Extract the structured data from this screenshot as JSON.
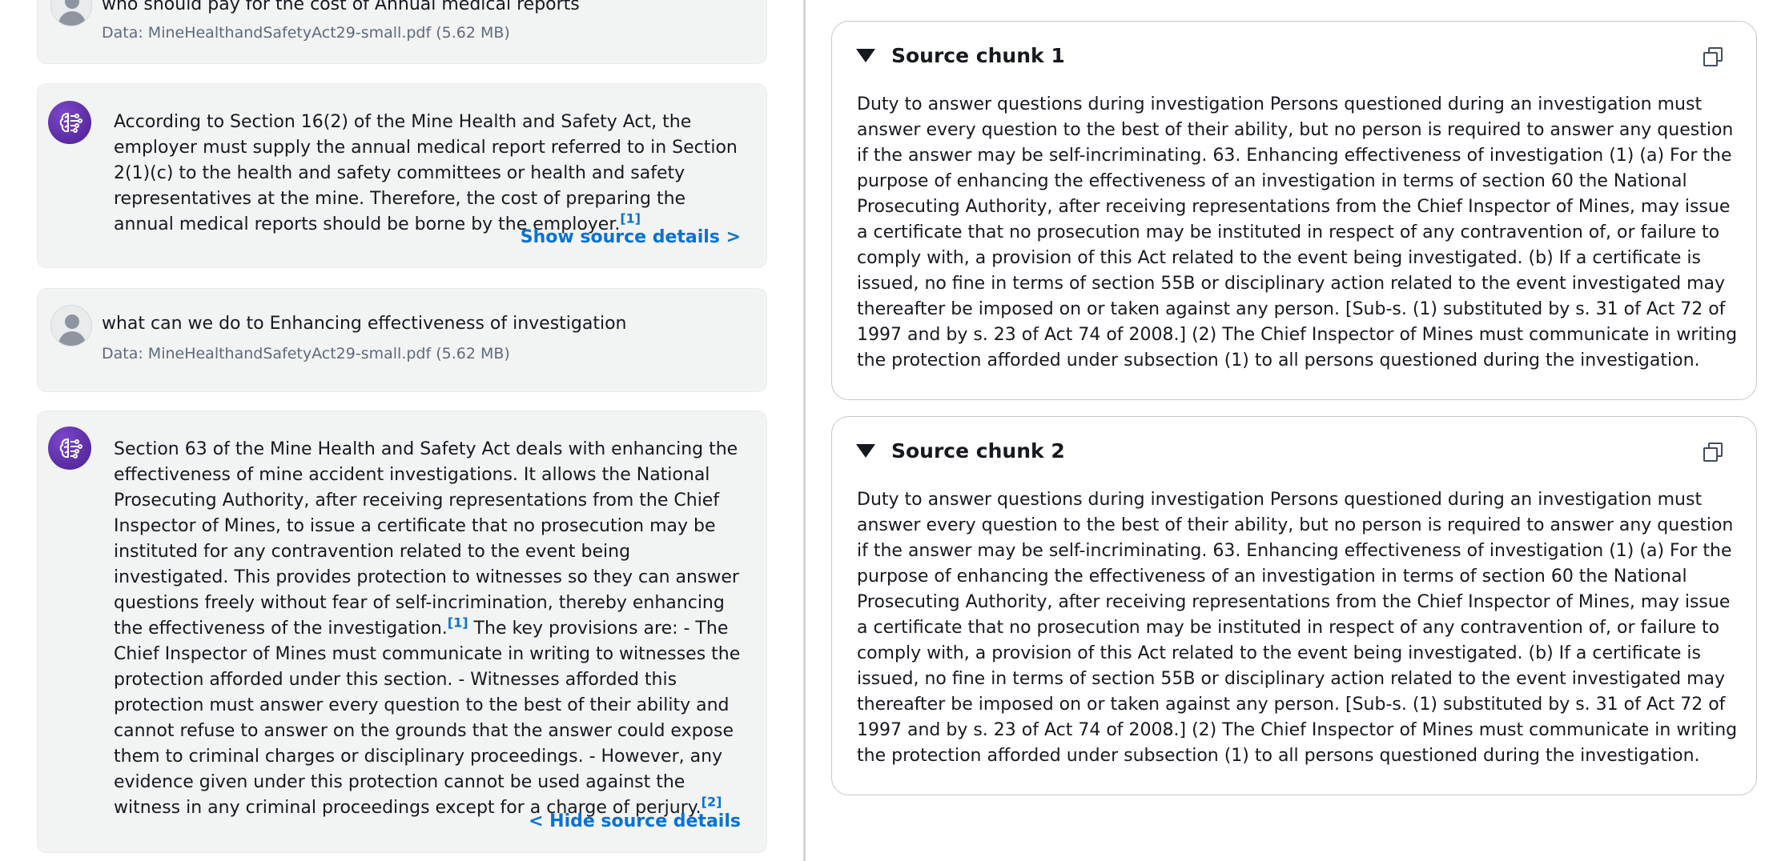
{
  "chat": {
    "messages": [
      {
        "role": "user",
        "text": "who should pay for the cost of Annual medical reports",
        "meta": "Data: MineHealthandSafetyAct29-small.pdf (5.62 MB)"
      },
      {
        "role": "assistant",
        "text": "According to Section 16(2) of the Mine Health and Safety Act, the employer must supply the annual medical report referred to in Section 2(1)(c) to the health and safety committees or health and safety representatives at the mine. Therefore, the cost of preparing the annual medical reports should be borne by the employer.",
        "cite": "[1]",
        "link": "Show source details >"
      },
      {
        "role": "user",
        "text": "what can we do to Enhancing effectiveness of investigation",
        "meta": "Data: MineHealthandSafetyAct29-small.pdf (5.62 MB)"
      },
      {
        "role": "assistant",
        "text_part1": "Section 63 of the Mine Health and Safety Act deals with enhancing the effectiveness of mine accident investigations. It allows the National Prosecuting Authority, after receiving representations from the Chief Inspector of Mines, to issue a certificate that no prosecution may be instituted for any contravention related to the event being investigated. This provides protection to witnesses so they can answer questions freely without fear of self-incrimination, thereby enhancing the effectiveness of the investigation.",
        "cite1": "[1]",
        "text_part2": " The key provisions are: - The Chief Inspector of Mines must communicate in writing to witnesses the protection afforded under this section. - Witnesses afforded this protection must answer every question to the best of their ability and cannot refuse to answer on the grounds that the answer could expose them to criminal charges or disciplinary proceedings. - However, any evidence given under this protection cannot be used against the witness in any criminal proceedings except for a charge of perjury.",
        "cite2": "[2]",
        "link": "< Hide source details"
      }
    ]
  },
  "sources": {
    "chunks": [
      {
        "title": "Source chunk 1",
        "body": "Duty to answer questions during investigation Persons questioned during an investigation must answer every question to the best of their ability, but no person is required to answer any question if the answer may be self-incriminating. 63. Enhancing effectiveness of investigation (1) (a) For the purpose of enhancing the effectiveness of an investigation in terms of section 60 the National Prosecuting Authority, after receiving representations from the Chief Inspector of Mines, may issue a certificate that no prosecution may be instituted in respect of any contravention of, or failure to comply with, a provision of this Act related to the event being investigated. (b) If a certificate is issued, no fine in terms of section 55B or disciplinary action related to the event investigated may thereafter be imposed on or taken against any person. [Sub-s. (1) substituted by s. 31 of Act 72 of 1997 and by s. 23 of Act 74 of 2008.] (2) The Chief Inspector of Mines must communicate in writing the protection afforded under subsection (1) to all persons questioned during the investigation."
      },
      {
        "title": "Source chunk 2",
        "body": "Duty to answer questions during investigation Persons questioned during an investigation must answer every question to the best of their ability, but no person is required to answer any question if the answer may be self-incriminating. 63. Enhancing effectiveness of investigation (1) (a) For the purpose of enhancing the effectiveness of an investigation in terms of section 60 the National Prosecuting Authority, after receiving representations from the Chief Inspector of Mines, may issue a certificate that no prosecution may be instituted in respect of any contravention of, or failure to comply with, a provision of this Act related to the event being investigated. (b) If a certificate is issued, no fine in terms of section 55B or disciplinary action related to the event investigated may thereafter be imposed on or taken against any person. [Sub-s. (1) substituted by s. 31 of Act 72 of 1997 and by s. 23 of Act 74 of 2008.] (2) The Chief Inspector of Mines must communicate in writing the protection afforded under subsection (1) to all persons questioned during the investigation."
      }
    ]
  },
  "icons": {
    "user_avatar": "user-avatar-icon",
    "assistant_avatar": "brain-circuit-icon",
    "expand": "caret-down-icon",
    "copy": "copy-icon"
  },
  "colors": {
    "link": "#0972d3",
    "assistant_avatar": "#5a2ca0",
    "card_bg": "#f2f3f3"
  }
}
